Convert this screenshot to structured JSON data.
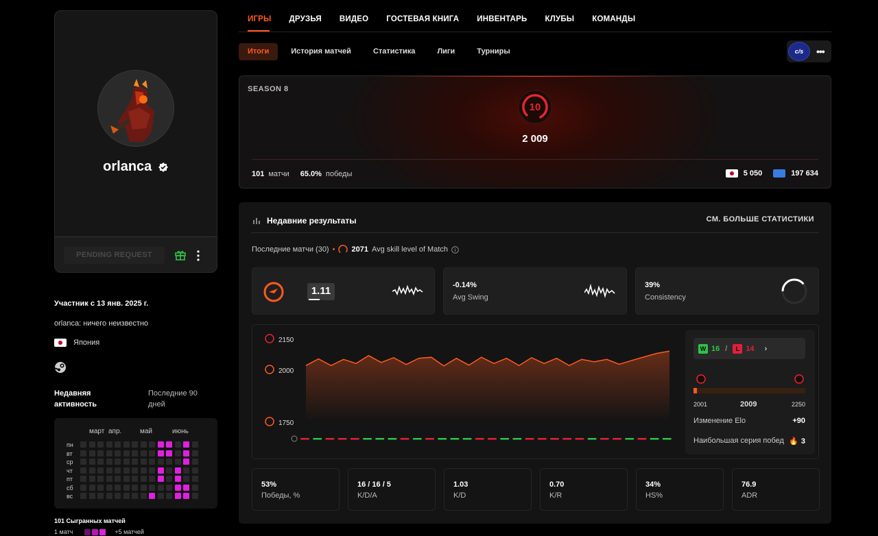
{
  "profile": {
    "nickname": "orlanca",
    "pending_label": "PENDING REQUEST",
    "member_since": "Участник с 13 янв. 2025 г.",
    "bio": "orlanca: ничего неизвестно",
    "country": "Япония",
    "activity_title": "Недавняя активность",
    "activity_period": "Последние 90 дней",
    "months": [
      "март",
      "апр.",
      "май",
      "июнь"
    ],
    "days": [
      "пн",
      "вт",
      "ср",
      "чт",
      "пт",
      "сб",
      "вс"
    ],
    "matches_played": "101 Сыгранных матчей",
    "legend_min": "1 матч",
    "legend_max": "+5 матчей"
  },
  "main_tabs": [
    "ИГРЫ",
    "ДРУЗЬЯ",
    "ВИДЕО",
    "ГОСТЕВАЯ КНИГА",
    "ИНВЕНТАРЬ",
    "КЛУБЫ",
    "КОМАНДЫ"
  ],
  "sub_tabs": [
    "Итоги",
    "История матчей",
    "Статистика",
    "Лиги",
    "Турниры"
  ],
  "game_logo": "c/s",
  "season": {
    "label": "SEASON 8",
    "level": "10",
    "elo": "2 009",
    "matches_count": "101",
    "matches_label": "матчи",
    "winrate": "65.0%",
    "wins_label": "победы",
    "country_rank": "5 050",
    "region_rank": "197 634"
  },
  "recent": {
    "title": "Недавние результаты",
    "see_more": "СМ. БОЛЬШЕ СТАТИСТИКИ",
    "last_matches": "Последние матчи (30)",
    "dot": "•",
    "avg_skill": "2071",
    "avg_skill_label": "Avg skill level of Match",
    "kpi": {
      "rating": "1.11",
      "swing_value": "-0.14%",
      "swing_label": "Avg Swing",
      "consistency_value": "39%",
      "consistency_label": "Consistency"
    },
    "chart_labels": {
      "y_top": "2150",
      "y_mid": "2000",
      "y_low": "1750"
    },
    "wins": "16",
    "losses": "14",
    "elo_min": "2001",
    "elo_current": "2009",
    "elo_max": "2250",
    "elo_change_label": "Изменение Elo",
    "elo_change": "+90",
    "streak_label": "Наибольшая серия побед",
    "streak": "3",
    "bottom": [
      {
        "value": "53%",
        "label": "Победы, %"
      },
      {
        "value": "16 / 16 / 5",
        "label": "K/D/A"
      },
      {
        "value": "1.03",
        "label": "K/D"
      },
      {
        "value": "0.70",
        "label": "K/R"
      },
      {
        "value": "34%",
        "label": "HS%"
      },
      {
        "value": "76.9",
        "label": "ADR"
      }
    ]
  },
  "chart_data": {
    "type": "line",
    "ylim": [
      1750,
      2150
    ],
    "values": [
      2020,
      2052,
      2020,
      2050,
      2030,
      2068,
      2035,
      2058,
      2025,
      2055,
      2060,
      2018,
      2055,
      2022,
      2060,
      2030,
      2055,
      2020,
      2058,
      2030,
      2055,
      2020,
      2050,
      2038,
      2050,
      2026,
      2045,
      2062,
      2079,
      2090
    ],
    "results": [
      "L",
      "W",
      "L",
      "L",
      "L",
      "W",
      "W",
      "W",
      "L",
      "W",
      "L",
      "W",
      "W",
      "W",
      "L",
      "L",
      "W",
      "W",
      "L",
      "L",
      "L",
      "L",
      "L",
      "W",
      "L",
      "L",
      "W",
      "L",
      "W",
      "W"
    ],
    "colors": {
      "line": "#ff5a1f",
      "win": "#2ec44a",
      "loss": "#e0203a"
    }
  }
}
